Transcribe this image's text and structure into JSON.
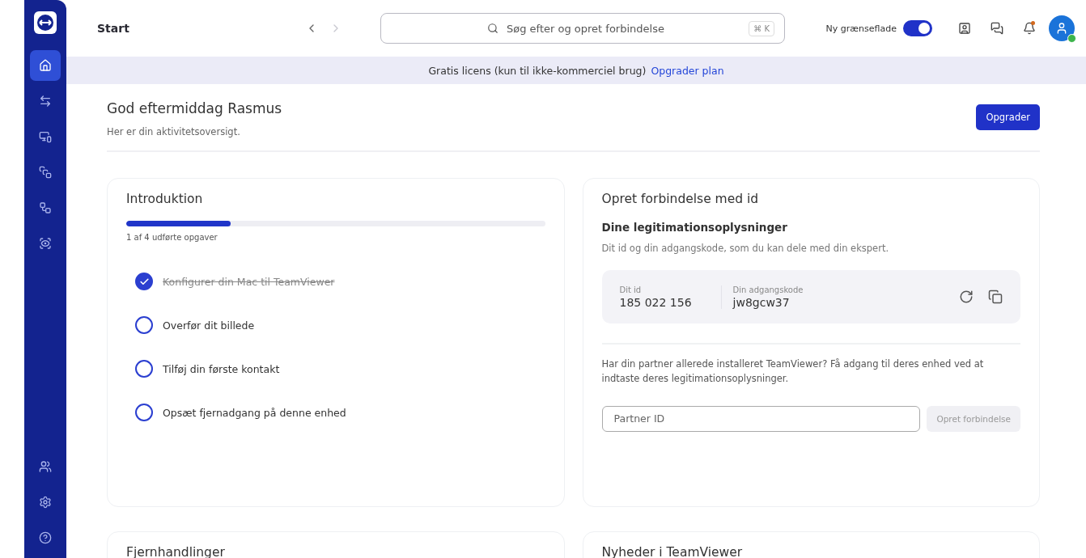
{
  "sidebar": {
    "items": [
      {
        "kind": "home",
        "selected": true
      },
      {
        "kind": "transfer",
        "selected": false
      },
      {
        "kind": "devices",
        "selected": false
      },
      {
        "kind": "sessions",
        "selected": false
      },
      {
        "kind": "flows",
        "selected": false
      },
      {
        "kind": "monitor",
        "selected": false
      }
    ],
    "bottom_items": [
      {
        "kind": "community"
      },
      {
        "kind": "settings"
      },
      {
        "kind": "help"
      }
    ]
  },
  "topbar": {
    "title": "Start",
    "search": {
      "placeholder": "Søg efter og opret forbindelse",
      "shortcut": "⌘ K"
    },
    "new_ui": {
      "label": "Ny grænseflade",
      "on": true
    },
    "notifications_unread": true,
    "user_online": true
  },
  "banner": {
    "text": "Gratis licens (kun til ikke-kommerciel brug)",
    "link": "Opgrader plan"
  },
  "greeting": {
    "title": "God eftermiddag Rasmus",
    "subtitle": "Her er din aktivitetsoversigt.",
    "button": "Opgrader"
  },
  "intro": {
    "title": "Introduktion",
    "level": 0.25,
    "caption": "1 af 4 udførte opgaver",
    "tasks": [
      {
        "label": "Konfigurer din Mac til TeamViewer",
        "done": true
      },
      {
        "label": "Overfør dit billede",
        "done": false
      },
      {
        "label": "Tilføj din første kontakt",
        "done": false
      },
      {
        "label": "Opsæt fjernadgang på denne enhed",
        "done": false
      }
    ]
  },
  "connect": {
    "title": "Opret forbindelse med id",
    "subtitle": "Dine legitimationsoplysninger",
    "description": "Dit id og din adgangskode, som du kan dele med din ekspert.",
    "credentials": [
      {
        "label": "Dit id",
        "value": "185 022 156"
      },
      {
        "label": "Din adgangskode",
        "value": "jw8gcw37"
      }
    ],
    "partner_text": "Har din partner allerede installeret TeamViewer? Få adgang til deres enhed ved at indtaste deres legitimationsoplysninger.",
    "partner_placeholder": "Partner ID",
    "button": {
      "label": "Opret forbindelse",
      "disabled": true
    }
  },
  "more_cards": [
    {
      "title": "Fjernhandlinger"
    },
    {
      "title": "Nyheder i TeamViewer"
    }
  ]
}
